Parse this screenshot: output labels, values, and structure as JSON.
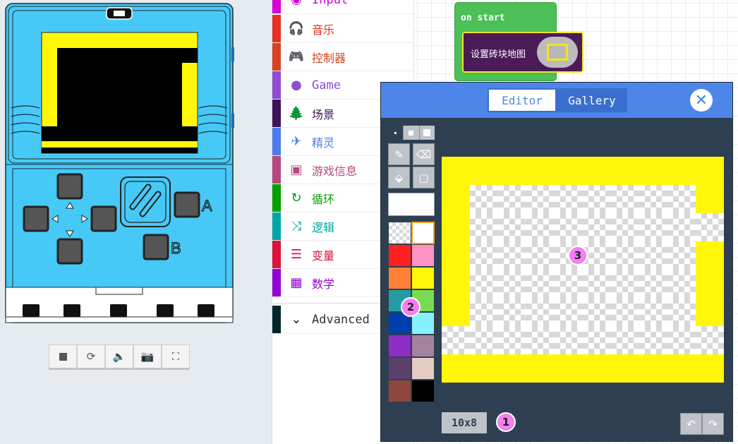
{
  "toolbox": {
    "categories": [
      {
        "label": "Input",
        "color": "#d400d4",
        "icon": "target-icon"
      },
      {
        "label": "音乐",
        "color": "#e63022",
        "icon": "headphones-icon"
      },
      {
        "label": "控制器",
        "color": "#d54322",
        "icon": "gamepad-icon"
      },
      {
        "label": "Game",
        "color": "#8f4bd1",
        "icon": "circle-icon"
      },
      {
        "label": "场景",
        "color": "#401255",
        "icon": "tree-icon"
      },
      {
        "label": "精灵",
        "color": "#4b7bec",
        "icon": "paper-plane-icon"
      },
      {
        "label": "游戏信息",
        "color": "#b4497f",
        "icon": "id-card-icon"
      },
      {
        "label": "循环",
        "color": "#00a000",
        "icon": "loop-icon"
      },
      {
        "label": "逻辑",
        "color": "#00a4a6",
        "icon": "shuffle-icon"
      },
      {
        "label": "变量",
        "color": "#dc143c",
        "icon": "list-icon"
      },
      {
        "label": "数学",
        "color": "#9400d3",
        "icon": "calculator-icon"
      }
    ],
    "advanced": {
      "label": "Advanced",
      "color": "#00272b",
      "icon": "chevron-down-icon"
    }
  },
  "workspace": {
    "on_start_label": "on start",
    "set_map_label": "设置砖块地图"
  },
  "editor": {
    "tabs": {
      "editor": "Editor",
      "gallery": "Gallery"
    },
    "close_icon": "close-icon",
    "size_label": "10x8",
    "palette": [
      "transparent",
      "#ffffff",
      "#ff2121",
      "#ff93c4",
      "#ff8135",
      "#fff609",
      "#249ca3",
      "#78dc52",
      "#003fad",
      "#87f2ff",
      "#8e2ec4",
      "#a4839f",
      "#5c406c",
      "#e5cdc4",
      "#91463d",
      "#000000"
    ],
    "selected_swatch": 1,
    "current_color": "#ffffff",
    "tilemap_rows": [
      "YYYYYYYYYY",
      "Y........Y",
      "Y.........",
      "Y........Y",
      "Y........Y",
      "Y........Y",
      "..........",
      "YYYYYYYYYY"
    ],
    "tilemap_color": "#fff609"
  },
  "markers": [
    "1",
    "2",
    "3"
  ]
}
